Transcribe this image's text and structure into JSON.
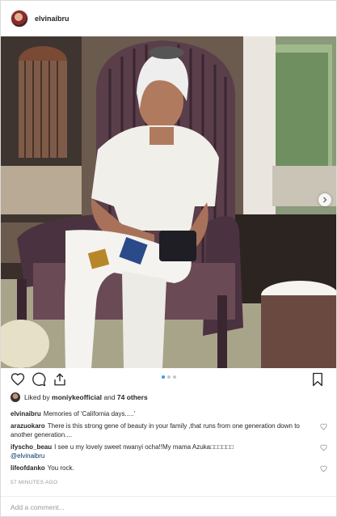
{
  "header": {
    "username": "elvinaibru"
  },
  "photo": {
    "alt": "",
    "next_icon": "chevron-right-icon"
  },
  "actions": {
    "like_icon": "heart-icon",
    "comment_icon": "comment-bubble-icon",
    "share_icon": "share-icon",
    "save_icon": "bookmark-icon",
    "carousel_count": 3,
    "carousel_active": 0
  },
  "likes": {
    "prefix": "Liked by",
    "user": "moniykeofficial",
    "and_text": "and",
    "others": "74 others"
  },
  "comments": [
    {
      "user": "elvinaibru",
      "text": "Memories of 'California days.....'",
      "mention": "",
      "has_heart": false
    },
    {
      "user": "arazuokaro",
      "text": "There is this strong gene of beauty in your family ,that runs from one generation down to another generation....",
      "mention": "",
      "has_heart": true
    },
    {
      "user": "ifyscho_beau",
      "text": "I see u my lovely sweet nwanyi ocha!!My mama Azuka□□□□□□",
      "mention": "@elvinaibru",
      "has_heart": true
    },
    {
      "user": "lifeofdanko",
      "text": "You rock.",
      "mention": "",
      "has_heart": true
    }
  ],
  "timestamp": "57 MINUTES AGO",
  "add_comment": {
    "placeholder": "Add a comment..."
  },
  "colors": {
    "accent": "#3897f0",
    "border": "#dbdbdb",
    "text": "#262626",
    "muted": "#999999",
    "mention": "#003569"
  }
}
